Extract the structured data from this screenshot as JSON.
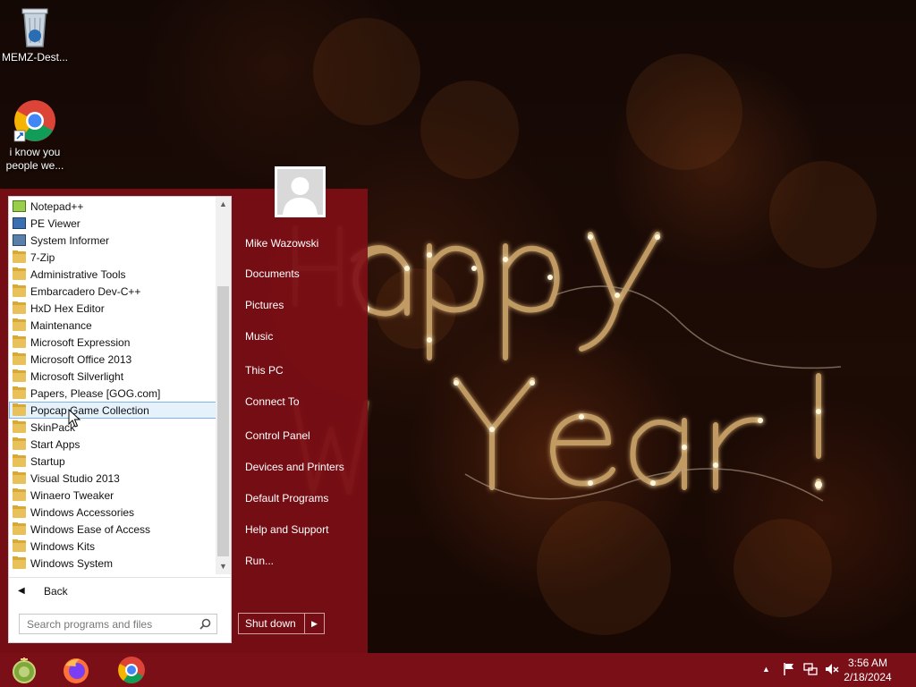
{
  "desktop": {
    "icons": [
      {
        "label": "MEMZ-Dest...",
        "icon": "recycle-bin-icon"
      },
      {
        "label": "i know you people we...",
        "icon": "chrome-shortcut-icon"
      }
    ],
    "wallpaper_text": "Happy New Year!"
  },
  "start_menu": {
    "programs": [
      {
        "label": "Notepad++",
        "icon": "notepadpp-icon"
      },
      {
        "label": "PE Viewer",
        "icon": "pe-viewer-icon"
      },
      {
        "label": "System Informer",
        "icon": "system-informer-icon"
      },
      {
        "label": "7-Zip",
        "icon": "folder-icon"
      },
      {
        "label": "Administrative Tools",
        "icon": "folder-icon"
      },
      {
        "label": "Embarcadero Dev-C++",
        "icon": "folder-icon"
      },
      {
        "label": "HxD Hex Editor",
        "icon": "folder-icon"
      },
      {
        "label": "Maintenance",
        "icon": "folder-icon"
      },
      {
        "label": "Microsoft Expression",
        "icon": "folder-icon"
      },
      {
        "label": "Microsoft Office 2013",
        "icon": "folder-icon"
      },
      {
        "label": "Microsoft Silverlight",
        "icon": "folder-icon"
      },
      {
        "label": "Papers, Please [GOG.com]",
        "icon": "folder-icon"
      },
      {
        "label": "Popcap Game Collection",
        "icon": "folder-icon",
        "selected": true
      },
      {
        "label": "SkinPack",
        "icon": "folder-icon"
      },
      {
        "label": "Start Apps",
        "icon": "folder-icon"
      },
      {
        "label": "Startup",
        "icon": "folder-icon"
      },
      {
        "label": "Visual Studio 2013",
        "icon": "folder-icon"
      },
      {
        "label": "Winaero Tweaker",
        "icon": "folder-icon"
      },
      {
        "label": "Windows Accessories",
        "icon": "folder-icon"
      },
      {
        "label": "Windows Ease of Access",
        "icon": "folder-icon"
      },
      {
        "label": "Windows Kits",
        "icon": "folder-icon"
      },
      {
        "label": "Windows System",
        "icon": "folder-icon"
      }
    ],
    "back_label": "Back",
    "search_placeholder": "Search programs and files",
    "user_name": "Mike Wazowski",
    "right_links": {
      "documents": "Documents",
      "pictures": "Pictures",
      "music": "Music",
      "this_pc": "This PC",
      "connect_to": "Connect To",
      "control_panel": "Control Panel",
      "devices_printers": "Devices and Printers",
      "default_programs": "Default Programs",
      "help_support": "Help and Support",
      "run": "Run..."
    },
    "shutdown_label": "Shut down"
  },
  "taskbar": {
    "apps": [
      "start-orb-icon",
      "firefox-icon",
      "chrome-icon"
    ],
    "tray_icons": [
      "show-hidden-icons-chevron",
      "action-center-flag-icon",
      "network-icon",
      "volume-muted-icon"
    ],
    "time": "3:56 AM",
    "date": "2/18/2024"
  },
  "colors": {
    "start_menu_bg": "#800e16",
    "taskbar_bg": "#7a0f18",
    "selection_bg": "#e5f1fb",
    "selection_border": "#7eb4ea"
  }
}
